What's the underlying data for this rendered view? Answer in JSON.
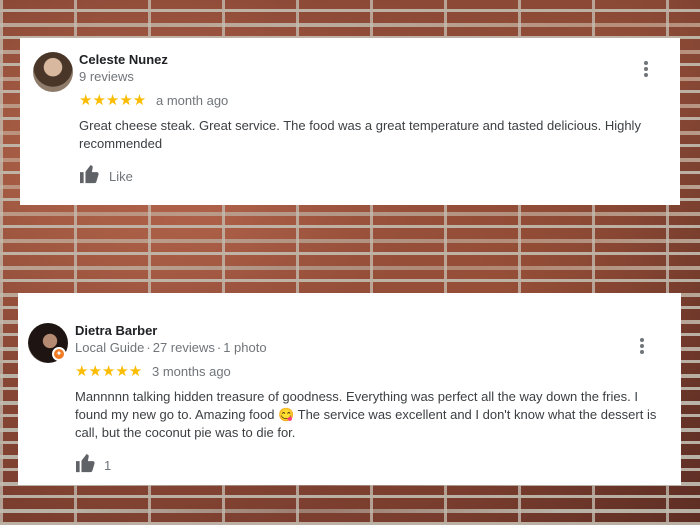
{
  "reviews": [
    {
      "author": "Celeste Nunez",
      "meta_reviews": "9 reviews",
      "rating_stars": "★★★★★",
      "rating": 5,
      "time": "a month ago",
      "text": "Great cheese steak. Great service. The food was a great temperature and tasted delicious. Highly recommended",
      "like_label": "Like",
      "icons": {
        "menu": "more-vert-icon",
        "like": "thumbs-up-icon"
      }
    },
    {
      "author": "Dietra Barber",
      "meta_guide": "Local Guide",
      "meta_reviews": "27 reviews",
      "meta_photos": "1 photo",
      "separator": "·",
      "rating_stars": "★★★★★",
      "rating": 5,
      "time": "3 months ago",
      "text": "Mannnnn talking hidden treasure of goodness. Everything was perfect all the way down the fries. I found my new go to. Amazing food 😋 The service was excellent and I don't know what the dessert is call, but the coconut pie was to die for.",
      "like_label": "1",
      "icons": {
        "menu": "more-vert-icon",
        "like": "thumbs-up-icon",
        "badge": "local-guide-badge-icon"
      }
    }
  ],
  "colors": {
    "star": "#fbbc04",
    "badge": "#f07b24",
    "text": "#3c4043",
    "muted": "#70757a"
  }
}
